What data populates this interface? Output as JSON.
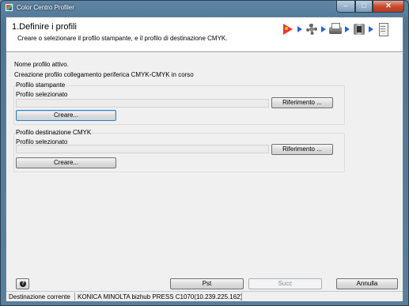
{
  "window": {
    "title": "Color Centro Profiler"
  },
  "header": {
    "step_title": "1.Definire i profili",
    "step_description": "Creare o selezionare il profilo stampante, e il profilo di destinazione CMYK.",
    "wizard_icons": [
      "play-icon",
      "gear-icon",
      "printer-icon",
      "device-icon",
      "document-icon"
    ]
  },
  "main": {
    "active_profile_label": "Nome profilo attivo.",
    "status_line": "Creazione profilo collegamento periferica CMYK-CMYK in corso",
    "printer_profile": {
      "group_label": "Profilo stampante",
      "selected_label": "Profilo selezionato",
      "selected_value": "",
      "reference_button": "Riferimento ...",
      "create_button": "Creare..."
    },
    "cmyk_profile": {
      "group_label": "Profilo destinazione CMYK",
      "selected_label": "Profilo selezionato",
      "selected_value": "",
      "reference_button": "Riferimento ...",
      "create_button": "Creare..."
    }
  },
  "footer": {
    "help_glyph": "?",
    "prev_button": "Pst",
    "next_button": "Succ",
    "cancel_button": "Annulla"
  },
  "statusbar": {
    "label": "Destinazione corrente",
    "value": "KONICA MINOLTA bizhub PRESS C1070(10.239.225.162)"
  }
}
